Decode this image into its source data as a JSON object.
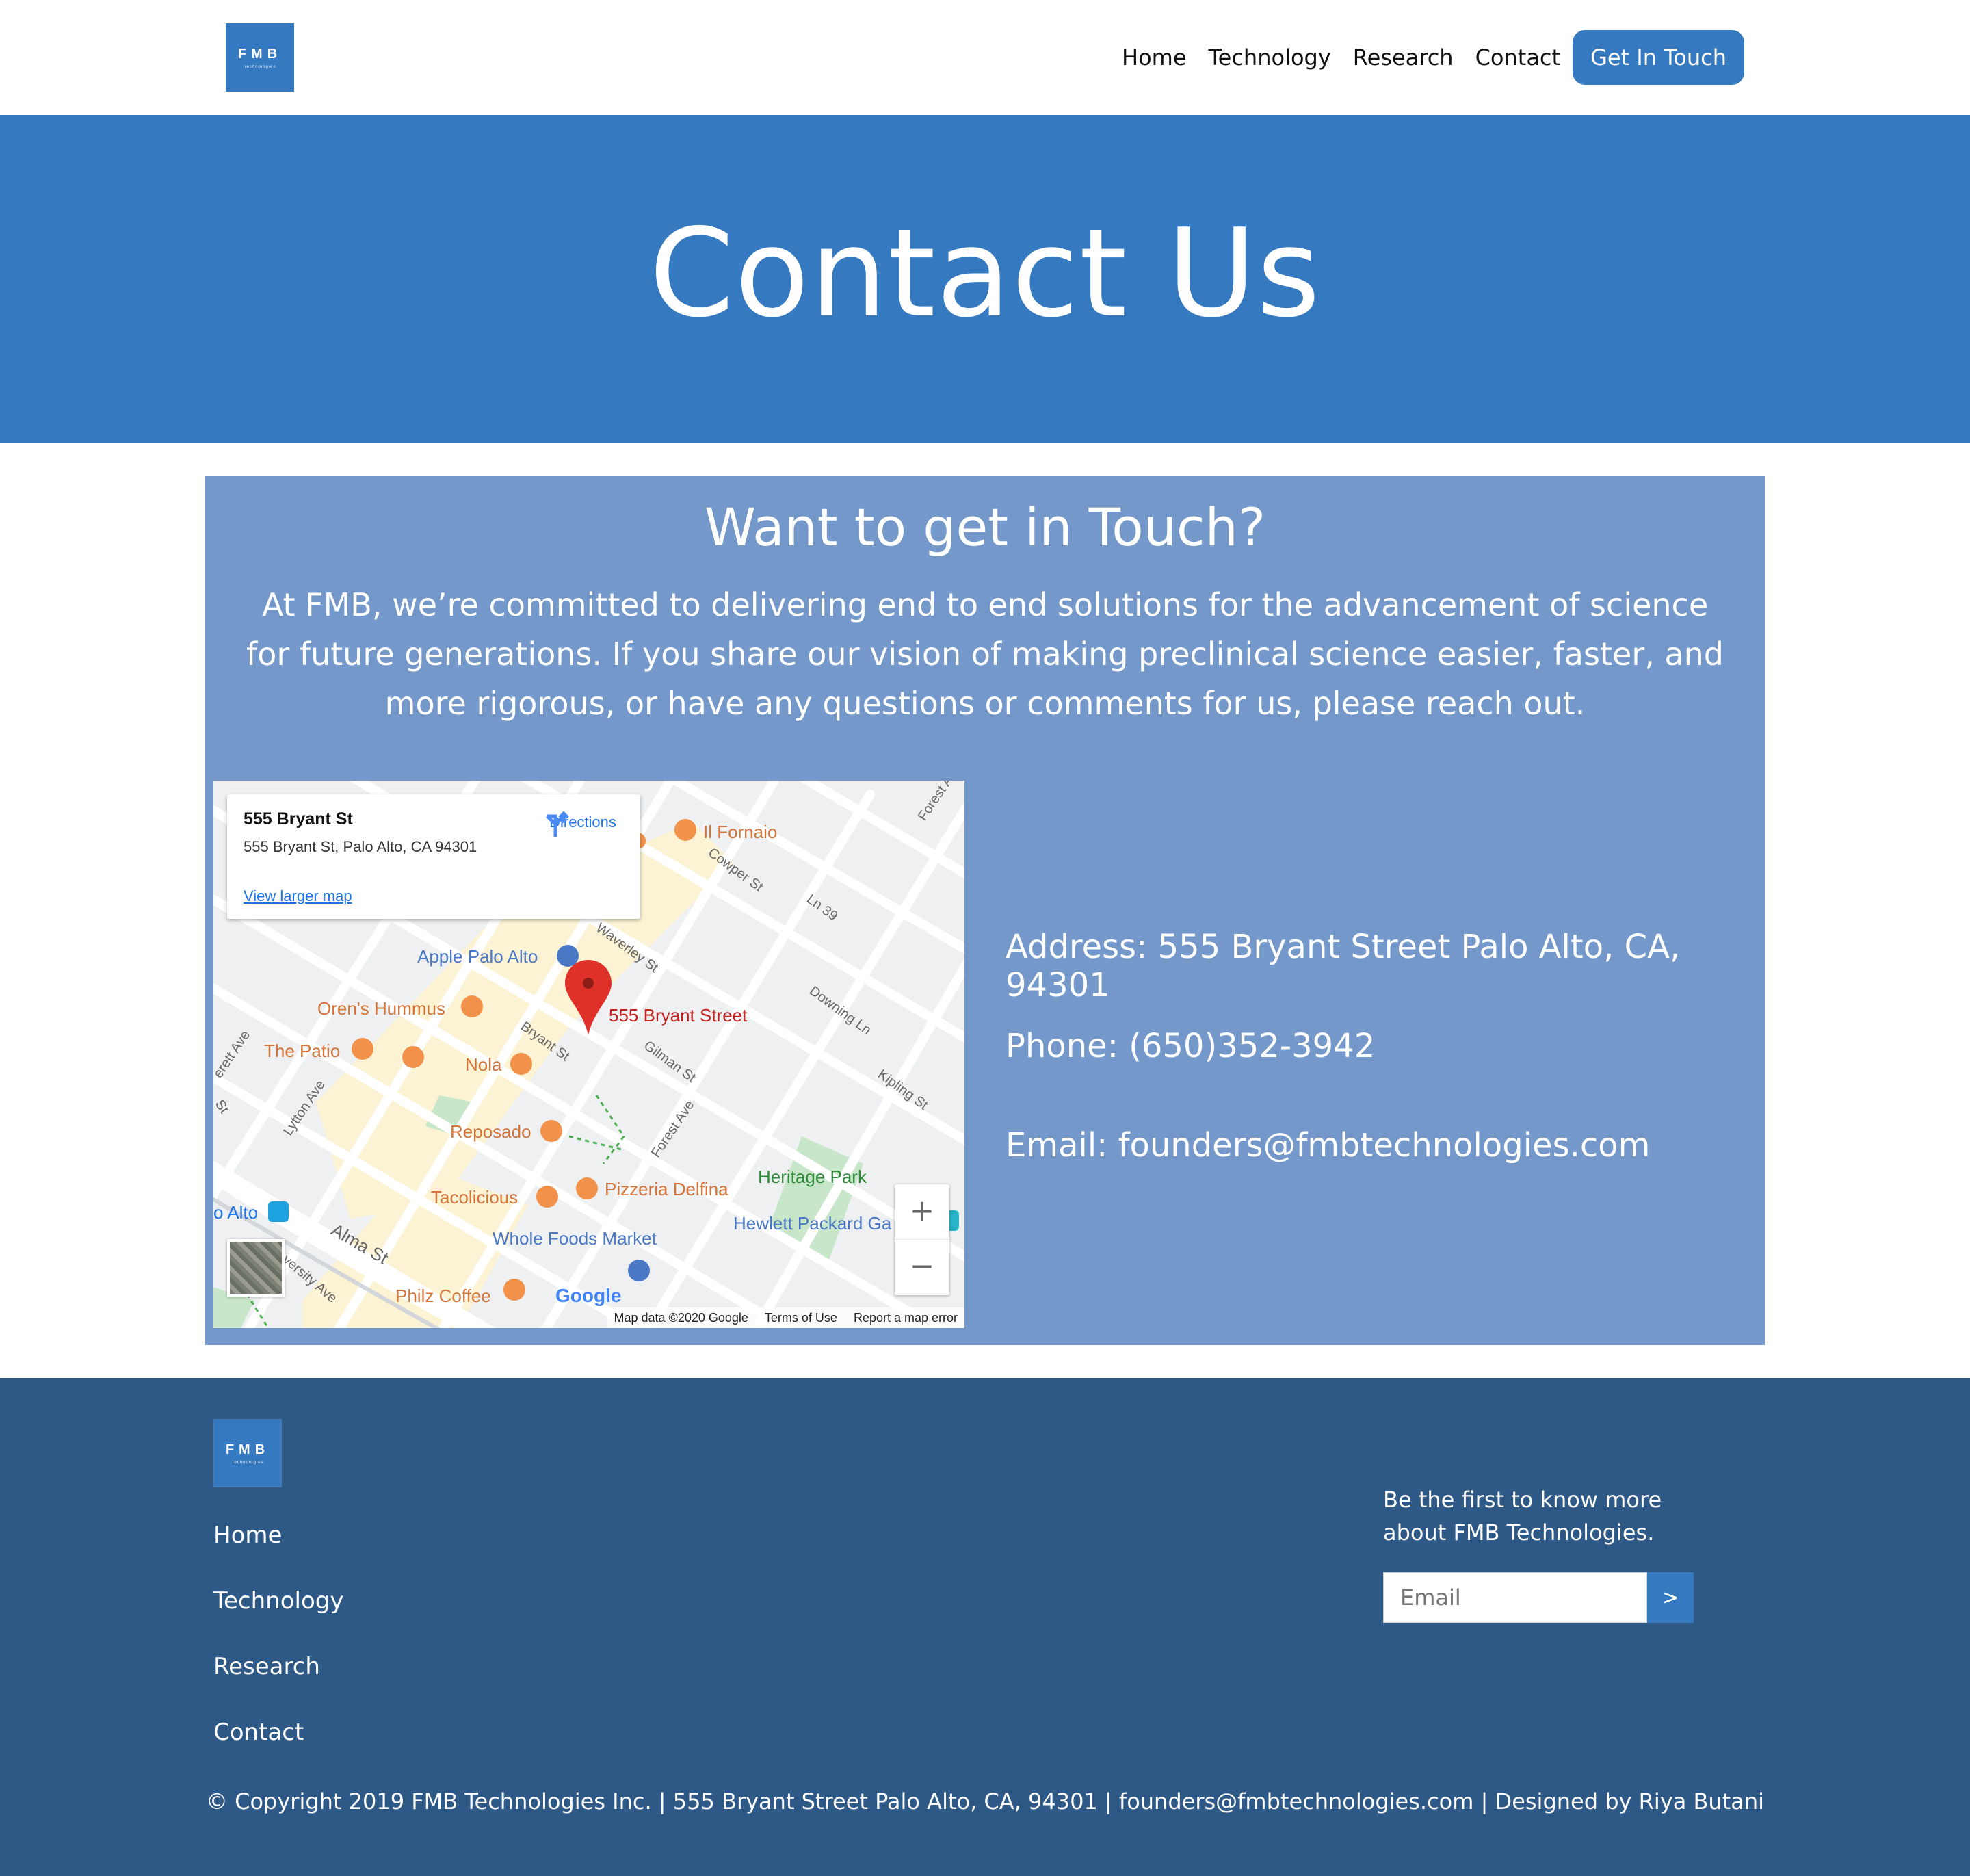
{
  "brand": {
    "logo_text": "FMB",
    "logo_subtext": "Technologies"
  },
  "nav": {
    "items": [
      "Home",
      "Technology",
      "Research",
      "Contact"
    ],
    "cta_label": "Get In Touch"
  },
  "hero": {
    "title": "Contact Us"
  },
  "contact": {
    "heading": "Want to get in Touch?",
    "intro": "At FMB, we’re committed to delivering end to end solutions for the advancement of science for future generations. If you share our vision of making preclinical science easier, faster, and more rigorous, or have any questions or comments for us, please reach out.",
    "address": "Address: 555 Bryant Street Palo Alto, CA, 94301",
    "phone": "Phone: (650)352-3942",
    "email": "Email: founders@fmbtechnologies.com"
  },
  "map": {
    "place_title": "555 Bryant St",
    "place_address": "555 Bryant St, Palo Alto, CA 94301",
    "directions_label": "Directions",
    "view_larger_label": "View larger map",
    "marker_label": "555 Bryant Street",
    "zoom_in": "+",
    "zoom_out": "−",
    "footer": {
      "map_data": "Map data ©2020 Google",
      "terms": "Terms of Use",
      "report": "Report a map error"
    },
    "labels": {
      "il_fornaio": "Il Fornaio",
      "apple": "Apple Palo Alto",
      "orens": "Oren's Hummus",
      "patio": "The Patio",
      "nola": "Nola",
      "reposado": "Reposado",
      "tacolicious": "Tacolicious",
      "pizzeria": "Pizzeria Delfina",
      "whole_foods": "Whole Foods Market",
      "philz": "Philz Coffee",
      "heritage": "Heritage Park",
      "hewlett": "Hewlett Packard Ga",
      "palo_alto_station": "o Alto",
      "google": "Google",
      "cowper": "Cowper St",
      "waverley": "Waverley St",
      "bryant": "Bryant St",
      "gilman": "Gilman St",
      "downing": "Downing Ln",
      "kipling": "Kipling St",
      "forest_ave": "Forest Ave",
      "forest_ave_2": "Forest Ave",
      "ln39": "Ln 39",
      "lytton": "Lytton Ave",
      "alma": "Alma St",
      "university": "versity Ave",
      "everett": "erett Ave",
      "st": "St"
    }
  },
  "footer": {
    "nav": [
      "Home",
      "Technology",
      "Research",
      "Contact"
    ],
    "newsletter_text": "Be the first to know more about FMB Technologies.",
    "email_placeholder": "Email",
    "submit_label": ">",
    "copyright": "© Copyright 2019 FMB Technologies Inc. | 555 Bryant Street Palo Alto, CA, 94301 | founders@fmbtechnologies.com | Designed by Riya Butani"
  },
  "colors": {
    "primary": "#3579c0",
    "card": "#7398c9",
    "footer": "#2e5986",
    "map_poi_orange": "#e8864a",
    "map_poi_blue": "#4a78c4",
    "map_park_green": "#2e8b3a",
    "marker_red": "#e0302a"
  }
}
